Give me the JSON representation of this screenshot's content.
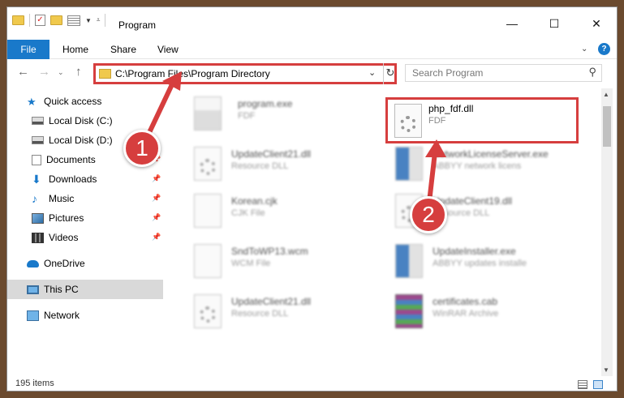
{
  "window": {
    "title": "Program",
    "controls": {
      "minimize": "—",
      "maximize": "☐",
      "close": "✕"
    }
  },
  "ribbon": {
    "tabs": [
      "File",
      "Home",
      "Share",
      "View"
    ],
    "help": "?"
  },
  "address": {
    "path": "C:\\Program Files\\Program Directory"
  },
  "search": {
    "placeholder": "Search Program"
  },
  "sidebar": {
    "items": [
      {
        "label": "Quick access",
        "icon": "star-icon"
      },
      {
        "label": "Local Disk (C:)",
        "icon": "drive-icon"
      },
      {
        "label": "Local Disk (D:)",
        "icon": "drive-icon"
      },
      {
        "label": "Documents",
        "icon": "documents-icon"
      },
      {
        "label": "Downloads",
        "icon": "download-icon"
      },
      {
        "label": "Music",
        "icon": "music-icon"
      },
      {
        "label": "Pictures",
        "icon": "pictures-icon"
      },
      {
        "label": "Videos",
        "icon": "videos-icon"
      },
      {
        "label": "OneDrive",
        "icon": "cloud-icon"
      },
      {
        "label": "This PC",
        "icon": "pc-icon"
      },
      {
        "label": "Network",
        "icon": "network-icon"
      }
    ]
  },
  "files": [
    {
      "name": "program.exe",
      "type": "FDF"
    },
    {
      "name": "php_fdf.dll",
      "type": "FDF"
    },
    {
      "name": "UpdateClient21.dll",
      "type": "Resource DLL"
    },
    {
      "name": "NetworkLicenseServer.exe",
      "type": "ABBYY network licens"
    },
    {
      "name": "Korean.cjk",
      "type": "CJK File"
    },
    {
      "name": "UpdateClient19.dll",
      "type": "Resource DLL"
    },
    {
      "name": "SndToWP13.wcm",
      "type": "WCM File"
    },
    {
      "name": "UpdateInstaller.exe",
      "type": "ABBYY updates installe"
    },
    {
      "name": "UpdateClient21.dll",
      "type": "Resource DLL"
    },
    {
      "name": "certificates.cab",
      "type": "WinRAR Archive"
    }
  ],
  "status": {
    "count": "195 items"
  },
  "annotations": [
    "1",
    "2"
  ],
  "colors": {
    "accent": "#1979ca",
    "highlight": "#d63e3e"
  }
}
